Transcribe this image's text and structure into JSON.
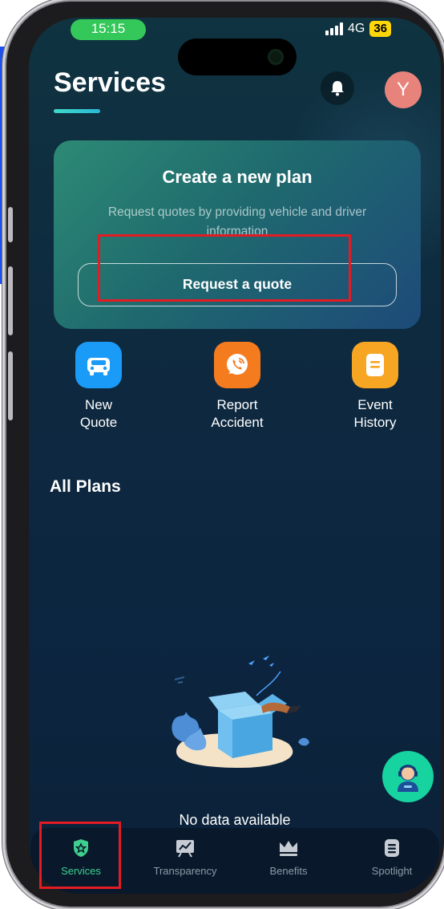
{
  "status_bar": {
    "time": "15:15",
    "network": "4G",
    "battery": "36"
  },
  "header": {
    "title": "Services"
  },
  "user": {
    "avatar_initial": "Y"
  },
  "plan_card": {
    "title": "Create a new plan",
    "description": "Request quotes by providing vehicle and driver information",
    "button_label": "Request a quote"
  },
  "quick_actions": [
    {
      "label": "New\nQuote",
      "icon": "car-icon",
      "color": "#1a9bf7"
    },
    {
      "label": "Report\nAccident",
      "icon": "phone-icon",
      "color": "#f57b1f"
    },
    {
      "label": "Event\nHistory",
      "icon": "document-icon",
      "color": "#f6a623"
    }
  ],
  "plans_section": {
    "title": "All Plans",
    "empty_text": "No data available"
  },
  "tab_bar": {
    "items": [
      {
        "label": "Services",
        "icon": "shield-star-icon",
        "active": true
      },
      {
        "label": "Transparency",
        "icon": "chart-board-icon",
        "active": false
      },
      {
        "label": "Benefits",
        "icon": "crown-icon",
        "active": false
      },
      {
        "label": "Spotlight",
        "icon": "list-icon",
        "active": false
      }
    ]
  },
  "colors": {
    "accent": "#3ecf8e",
    "highlight": "#e31b23",
    "background": "#0e2a3f"
  }
}
